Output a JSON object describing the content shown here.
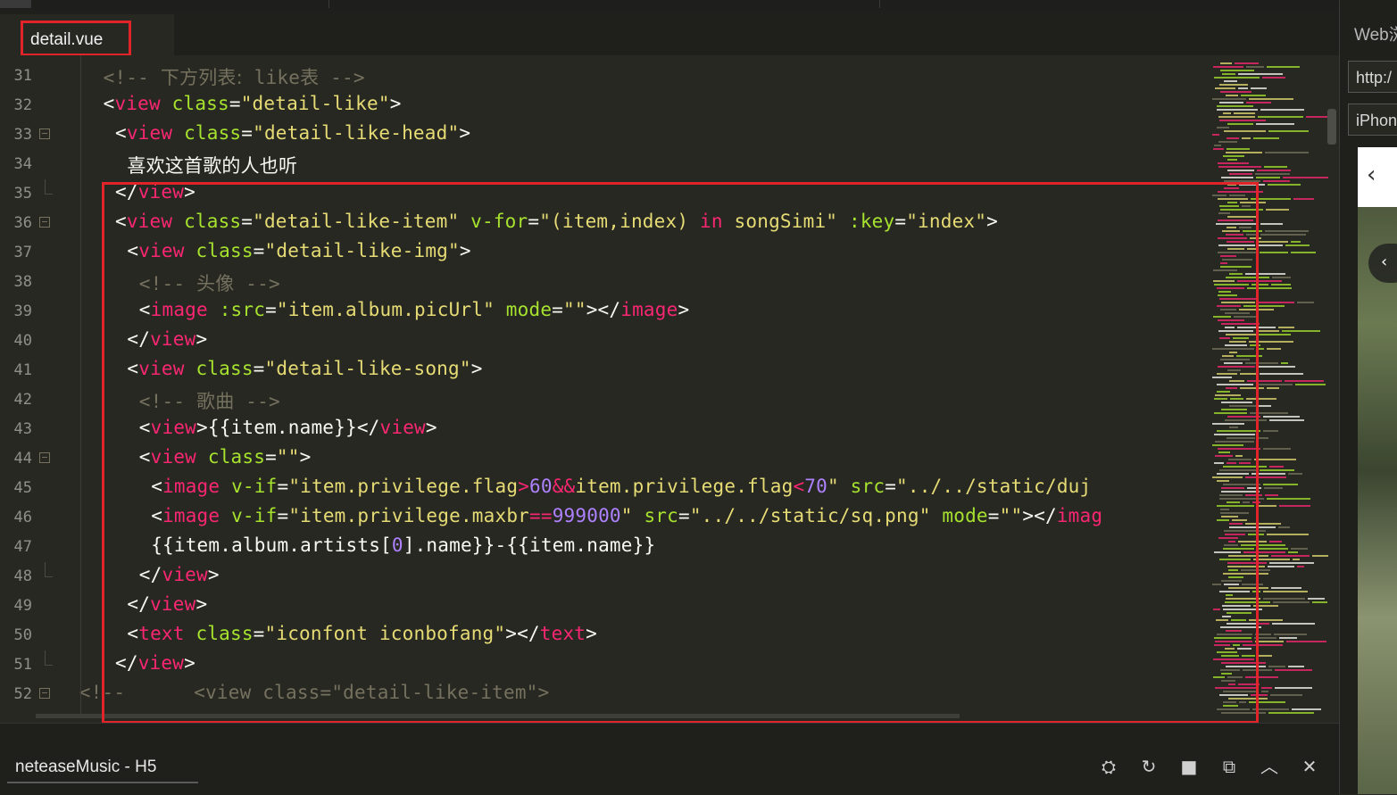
{
  "editor": {
    "tab_label": "detail.vue",
    "lines": [
      {
        "num": "31",
        "fold": "",
        "tokens": [
          [
            "cmt",
            "<!-- "
          ],
          [
            "cmt-cjk",
            "下方列表:"
          ],
          [
            "cmt",
            " like"
          ],
          [
            "cmt-cjk",
            "表"
          ],
          [
            "cmt",
            " -->"
          ]
        ],
        "indent": 4
      },
      {
        "num": "32",
        "fold": "",
        "tokens": [
          [
            "p",
            "<"
          ],
          [
            "tag",
            "view"
          ],
          [
            "p",
            " "
          ],
          [
            "attr",
            "class"
          ],
          [
            "p",
            "="
          ],
          [
            "str",
            "\"detail-like\""
          ],
          [
            "p",
            ">"
          ]
        ],
        "indent": 4
      },
      {
        "num": "33",
        "fold": "open",
        "tokens": [
          [
            "p",
            "<"
          ],
          [
            "tag",
            "view"
          ],
          [
            "p",
            " "
          ],
          [
            "attr",
            "class"
          ],
          [
            "p",
            "="
          ],
          [
            "str",
            "\"detail-like-head\""
          ],
          [
            "p",
            ">"
          ]
        ],
        "indent": 5
      },
      {
        "num": "34",
        "fold": "",
        "tokens": [
          [
            "txt-cjk",
            "喜欢这首歌的人也听"
          ]
        ],
        "indent": 6
      },
      {
        "num": "35",
        "fold": "end",
        "tokens": [
          [
            "p",
            "</"
          ],
          [
            "tag",
            "view"
          ],
          [
            "p",
            ">"
          ]
        ],
        "indent": 5
      },
      {
        "num": "36",
        "fold": "open",
        "tokens": [
          [
            "p",
            "<"
          ],
          [
            "tag",
            "view"
          ],
          [
            "p",
            " "
          ],
          [
            "attr",
            "class"
          ],
          [
            "p",
            "="
          ],
          [
            "str",
            "\"detail-like-item\""
          ],
          [
            "p",
            " "
          ],
          [
            "attr",
            "v-for"
          ],
          [
            "p",
            "="
          ],
          [
            "str",
            "\"(item,index) "
          ],
          [
            "tag",
            "in"
          ],
          [
            "str",
            " songSimi\""
          ],
          [
            "p",
            " "
          ],
          [
            "attr",
            ":key"
          ],
          [
            "p",
            "="
          ],
          [
            "str",
            "\"index\""
          ],
          [
            "p",
            ">"
          ]
        ],
        "indent": 5
      },
      {
        "num": "37",
        "fold": "",
        "tokens": [
          [
            "p",
            "<"
          ],
          [
            "tag",
            "view"
          ],
          [
            "p",
            " "
          ],
          [
            "attr",
            "class"
          ],
          [
            "p",
            "="
          ],
          [
            "str",
            "\"detail-like-img\""
          ],
          [
            "p",
            ">"
          ]
        ],
        "indent": 6
      },
      {
        "num": "38",
        "fold": "",
        "tokens": [
          [
            "cmt",
            "<!-- "
          ],
          [
            "cmt-cjk",
            "头像"
          ],
          [
            "cmt",
            " -->"
          ]
        ],
        "indent": 7
      },
      {
        "num": "39",
        "fold": "",
        "tokens": [
          [
            "p",
            "<"
          ],
          [
            "tag",
            "image"
          ],
          [
            "p",
            " "
          ],
          [
            "attr",
            ":src"
          ],
          [
            "p",
            "="
          ],
          [
            "str",
            "\"item.album.picUrl\""
          ],
          [
            "p",
            " "
          ],
          [
            "attr",
            "mode"
          ],
          [
            "p",
            "="
          ],
          [
            "str",
            "\"\""
          ],
          [
            "p",
            "></"
          ],
          [
            "tag",
            "image"
          ],
          [
            "p",
            ">"
          ]
        ],
        "indent": 7
      },
      {
        "num": "40",
        "fold": "",
        "tokens": [
          [
            "p",
            "</"
          ],
          [
            "tag",
            "view"
          ],
          [
            "p",
            ">"
          ]
        ],
        "indent": 6
      },
      {
        "num": "41",
        "fold": "",
        "tokens": [
          [
            "p",
            "<"
          ],
          [
            "tag",
            "view"
          ],
          [
            "p",
            " "
          ],
          [
            "attr",
            "class"
          ],
          [
            "p",
            "="
          ],
          [
            "str",
            "\"detail-like-song\""
          ],
          [
            "p",
            ">"
          ]
        ],
        "indent": 6
      },
      {
        "num": "42",
        "fold": "",
        "tokens": [
          [
            "cmt",
            "<!-- "
          ],
          [
            "cmt-cjk",
            "歌曲"
          ],
          [
            "cmt",
            " -->"
          ]
        ],
        "indent": 7
      },
      {
        "num": "43",
        "fold": "",
        "tokens": [
          [
            "p",
            "<"
          ],
          [
            "tag",
            "view"
          ],
          [
            "p",
            ">{{item.name}}</"
          ],
          [
            "tag",
            "view"
          ],
          [
            "p",
            ">"
          ]
        ],
        "indent": 7
      },
      {
        "num": "44",
        "fold": "open",
        "tokens": [
          [
            "p",
            "<"
          ],
          [
            "tag",
            "view"
          ],
          [
            "p",
            " "
          ],
          [
            "attr",
            "class"
          ],
          [
            "p",
            "="
          ],
          [
            "str",
            "\"\""
          ],
          [
            "p",
            ">"
          ]
        ],
        "indent": 7
      },
      {
        "num": "45",
        "fold": "",
        "tokens": [
          [
            "p",
            "<"
          ],
          [
            "tag",
            "image"
          ],
          [
            "p",
            " "
          ],
          [
            "attr",
            "v-if"
          ],
          [
            "p",
            "="
          ],
          [
            "str",
            "\"item.privilege.flag"
          ],
          [
            "tag",
            ">"
          ],
          [
            "num",
            "60"
          ],
          [
            "tag",
            "&&"
          ],
          [
            "str",
            "item.privilege.flag"
          ],
          [
            "tag",
            "<"
          ],
          [
            "num",
            "70"
          ],
          [
            "str",
            "\""
          ],
          [
            "p",
            " "
          ],
          [
            "attr",
            "src"
          ],
          [
            "p",
            "="
          ],
          [
            "str",
            "\"../../static/duj"
          ]
        ],
        "indent": 8
      },
      {
        "num": "46",
        "fold": "",
        "tokens": [
          [
            "p",
            "<"
          ],
          [
            "tag",
            "image"
          ],
          [
            "p",
            " "
          ],
          [
            "attr",
            "v-if"
          ],
          [
            "p",
            "="
          ],
          [
            "str",
            "\"item.privilege.maxbr"
          ],
          [
            "tag",
            "=="
          ],
          [
            "num",
            "999000"
          ],
          [
            "str",
            "\""
          ],
          [
            "p",
            " "
          ],
          [
            "attr",
            "src"
          ],
          [
            "p",
            "="
          ],
          [
            "str",
            "\"../../static/sq.png\""
          ],
          [
            "p",
            " "
          ],
          [
            "attr",
            "mode"
          ],
          [
            "p",
            "="
          ],
          [
            "str",
            "\"\""
          ],
          [
            "p",
            "></"
          ],
          [
            "tag",
            "imag"
          ]
        ],
        "indent": 8
      },
      {
        "num": "47",
        "fold": "",
        "tokens": [
          [
            "p",
            "{{item.album.artists["
          ],
          [
            "num",
            "0"
          ],
          [
            "p",
            "].name}}-{{item.name}}"
          ]
        ],
        "indent": 8
      },
      {
        "num": "48",
        "fold": "end",
        "tokens": [
          [
            "p",
            "</"
          ],
          [
            "tag",
            "view"
          ],
          [
            "p",
            ">"
          ]
        ],
        "indent": 7
      },
      {
        "num": "49",
        "fold": "",
        "tokens": [
          [
            "p",
            "</"
          ],
          [
            "tag",
            "view"
          ],
          [
            "p",
            ">"
          ]
        ],
        "indent": 6
      },
      {
        "num": "50",
        "fold": "",
        "tokens": [
          [
            "p",
            "<"
          ],
          [
            "tag",
            "text"
          ],
          [
            "p",
            " "
          ],
          [
            "attr",
            "class"
          ],
          [
            "p",
            "="
          ],
          [
            "str",
            "\"iconfont iconbofang\""
          ],
          [
            "p",
            "></"
          ],
          [
            "tag",
            "text"
          ],
          [
            "p",
            ">"
          ]
        ],
        "indent": 6
      },
      {
        "num": "51",
        "fold": "end",
        "tokens": [
          [
            "p",
            "</"
          ],
          [
            "tag",
            "view"
          ],
          [
            "p",
            ">"
          ]
        ],
        "indent": 5
      },
      {
        "num": "52",
        "fold": "open",
        "tokens": [
          [
            "cmt",
            "<!--      <view class=\"detail-like-item\">"
          ]
        ],
        "indent": 2
      }
    ]
  },
  "right_panel": {
    "title": "Web浏",
    "url_value": "http:/",
    "device_value": "iPhon",
    "back_icon": "chevron-left-icon"
  },
  "bottom_bar": {
    "label": "neteaseMusic - H5",
    "icons": [
      "debug-icon",
      "refresh-icon",
      "stop-icon",
      "console-icon",
      "chevron-up-icon",
      "collapse-icon"
    ],
    "glyphs": [
      "⛭",
      "↻",
      "■",
      "⧉",
      "︿",
      "✕"
    ]
  },
  "colors": {
    "highlight_border": "#e0242a",
    "background": "#272822"
  }
}
